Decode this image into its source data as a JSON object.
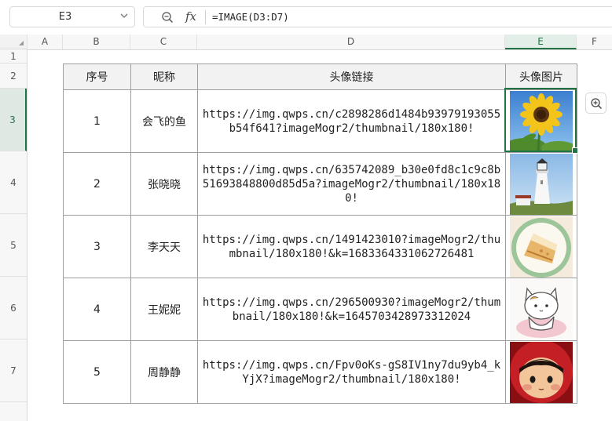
{
  "formula_bar": {
    "name_box": "E3",
    "formula": "=IMAGE(D3:D7)"
  },
  "columns": [
    "A",
    "B",
    "C",
    "D",
    "E",
    "F"
  ],
  "active_column": "E",
  "rows": [
    "1",
    "2",
    "3",
    "4",
    "5",
    "6",
    "7"
  ],
  "active_row": "3",
  "table": {
    "headers": [
      "序号",
      "昵称",
      "头像链接",
      "头像图片"
    ],
    "rows": [
      {
        "no": "1",
        "nickname": "会飞的鱼",
        "url": "https://img.qwps.cn/c2898286d1484b93979193055b54f641?imageMogr2/thumbnail/180x180!",
        "image": "sunflower"
      },
      {
        "no": "2",
        "nickname": "张晓晓",
        "url": "https://img.qwps.cn/635742089_b30e0fd8c1c9c8b51693848800d85d5a?imageMogr2/thumbnail/180x180!",
        "image": "lighthouse"
      },
      {
        "no": "3",
        "nickname": "李天天",
        "url": "https://img.qwps.cn/1491423010?imageMogr2/thumbnail/180x180!&k=1683364331062726481",
        "image": "cake"
      },
      {
        "no": "4",
        "nickname": "王妮妮",
        "url": "https://img.qwps.cn/296500930?imageMogr2/thumbnail/180x180!&k=1645703428973312024",
        "image": "cartoon-cat"
      },
      {
        "no": "5",
        "nickname": "周静静",
        "url": "https://img.qwps.cn/Fpv0oKs-gS8IV1ny7du9yb4_kYjX?imageMogr2/thumbnail/180x180!",
        "image": "red-hood-doll"
      }
    ]
  },
  "side_tool": {
    "icon": "zoom-in-icon"
  },
  "colors": {
    "accent": "#217346",
    "grid_border": "#9e9e9e",
    "header_bg": "#f2f2f2"
  }
}
